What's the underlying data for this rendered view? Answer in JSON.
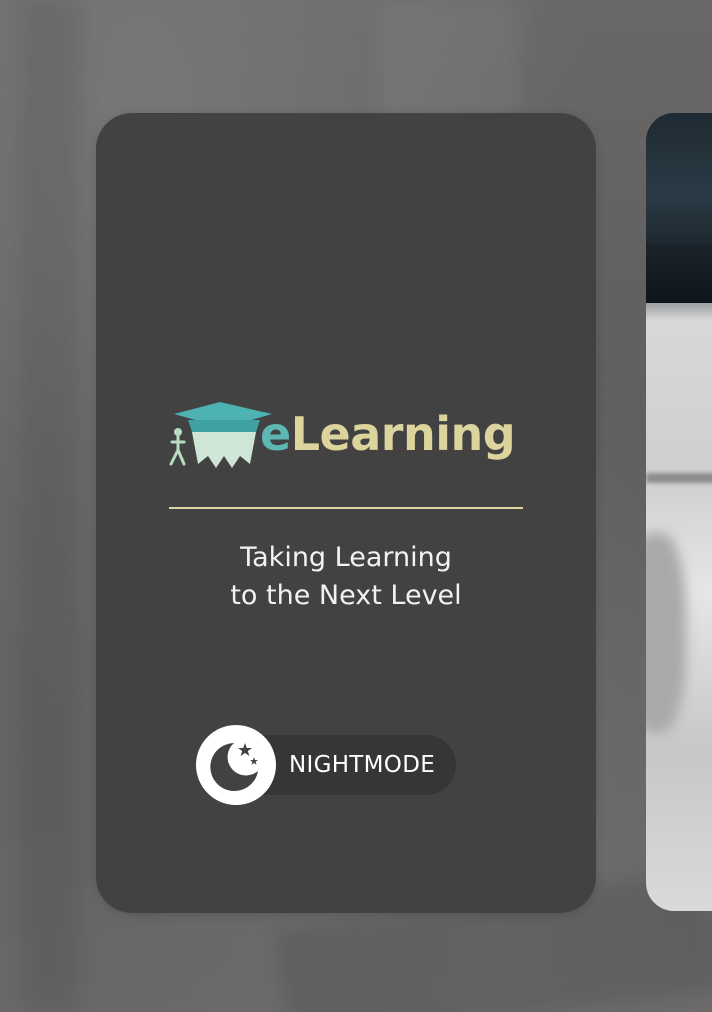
{
  "logo": {
    "e": "e",
    "rest": "Learning"
  },
  "tagline": {
    "line1": "Taking Learning",
    "line2": "to the Next Level"
  },
  "nightmode": {
    "label": "NIGHTMODE",
    "enabled": false
  },
  "colors": {
    "card": "#424242",
    "accent_teal": "#5fb7b4",
    "accent_gold": "#ddd39d",
    "toggle_pill": "#363636"
  },
  "icons": {
    "logo": "graduation-cap-logo-icon",
    "nightmode": "moon-stars-icon"
  }
}
